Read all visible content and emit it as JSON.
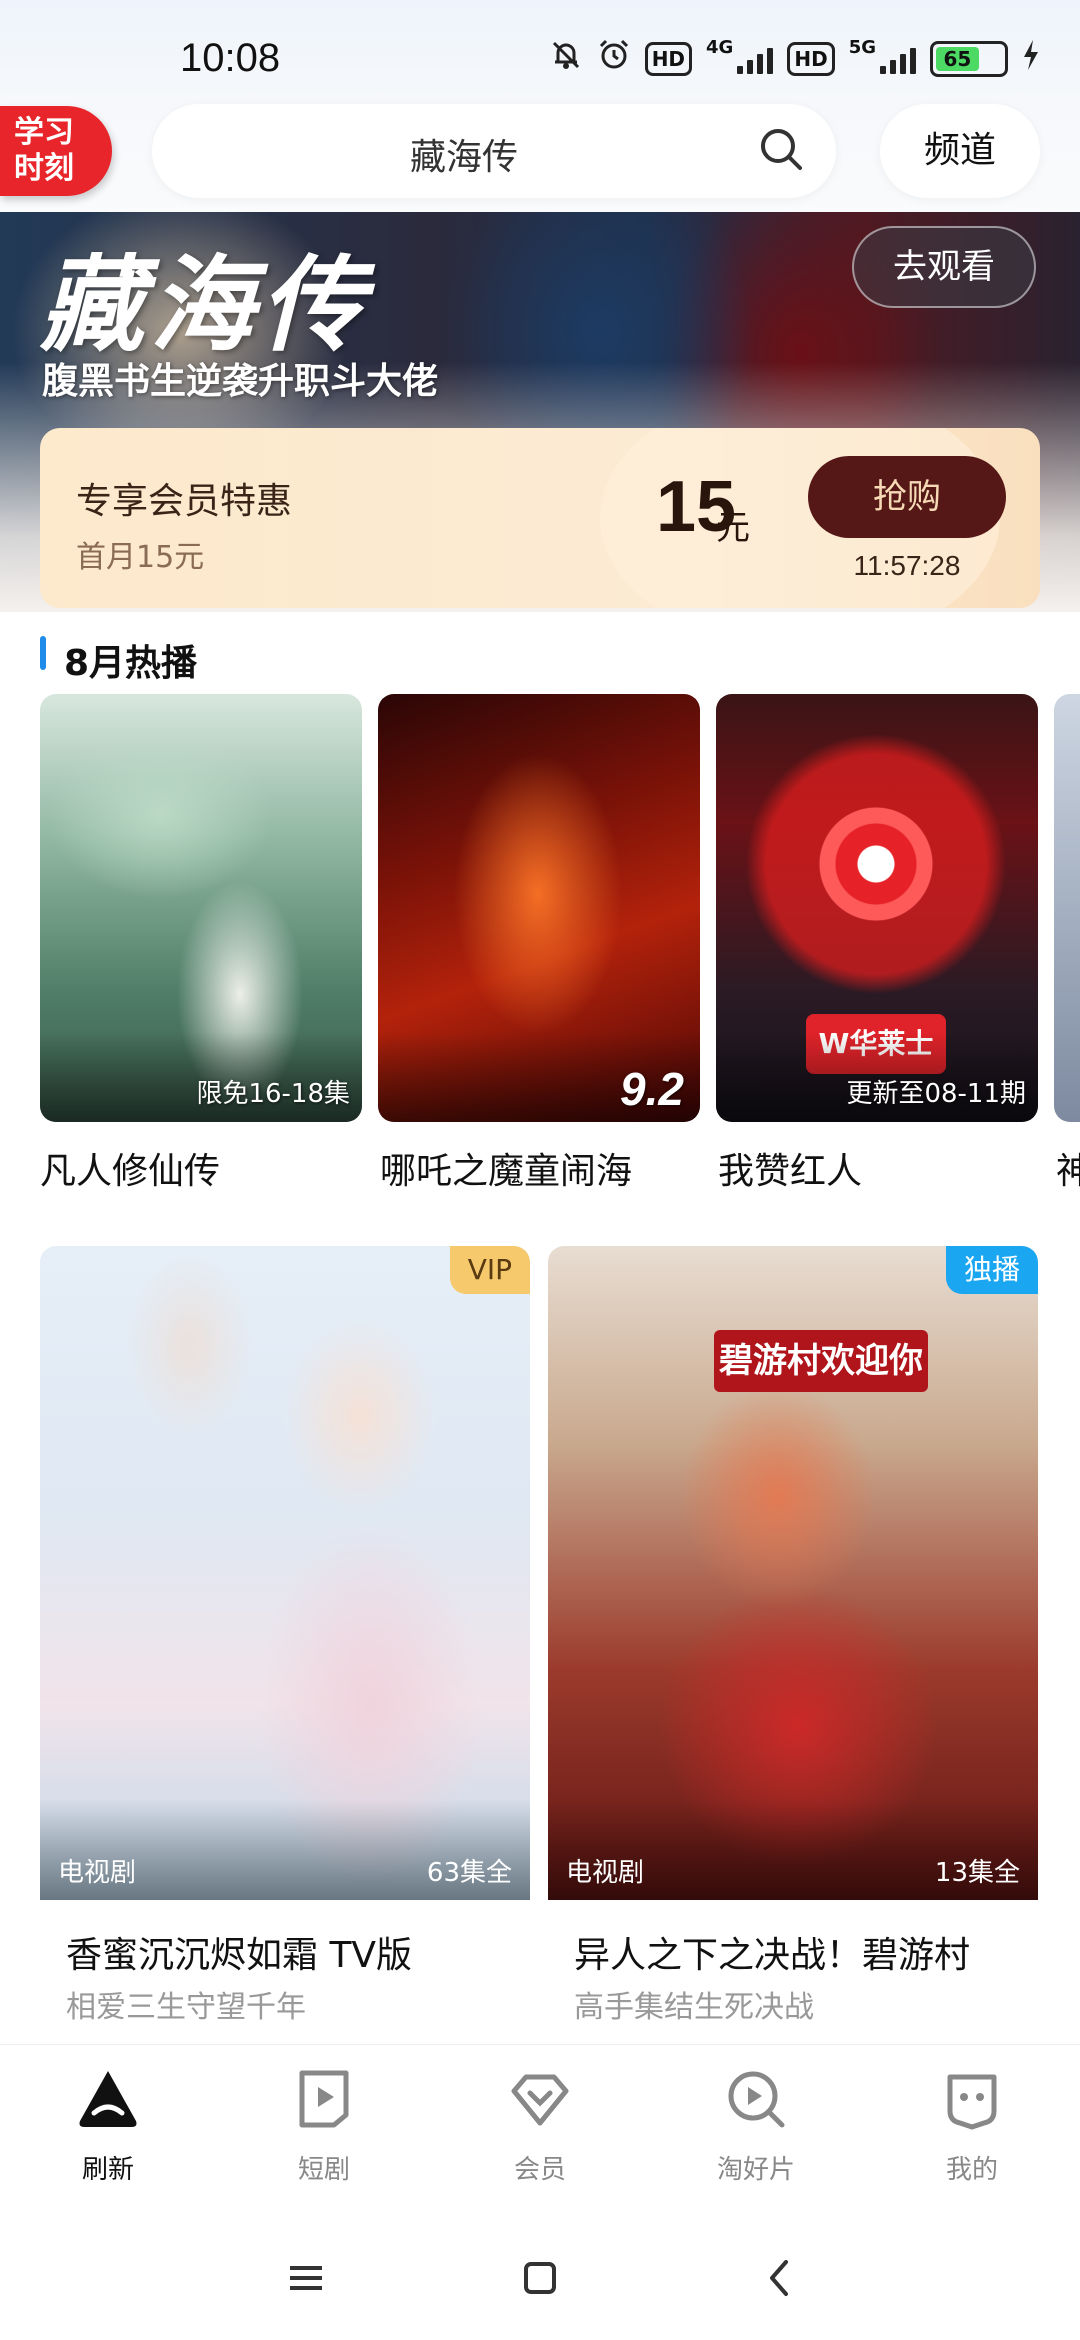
{
  "status": {
    "time": "10:08",
    "net1": "4G",
    "net2": "5G",
    "hd": "HD",
    "battery": "65"
  },
  "topbar": {
    "badge": "学习\n时刻",
    "search_text": "藏海传",
    "channel_label": "频道"
  },
  "hero": {
    "title": "藏海传",
    "subtitle": "腹黑书生逆袭升职斗大佬",
    "watch_label": "去观看"
  },
  "promo": {
    "title": "专享会员特惠",
    "subtitle": "首月15元",
    "price": "15",
    "unit": "元",
    "buy_label": "抢购",
    "countdown": "11:57:28"
  },
  "section": {
    "title": "8月热播"
  },
  "hot": [
    {
      "title": "凡人修仙传",
      "tag": "限免16-18集"
    },
    {
      "title": "哪吒之魔童闹海",
      "score": "9.2"
    },
    {
      "title": "我赞红人",
      "tag": "更新至08-11期",
      "logo": "W华莱士"
    },
    {
      "title": "神"
    }
  ],
  "cards": [
    {
      "title": "香蜜沉沉烬如霜 TV版",
      "subtitle": "相爱三生守望千年",
      "type": "电视剧",
      "episodes": "63集全",
      "badge": "VIP"
    },
    {
      "title": "异人之下之决战！碧游村",
      "subtitle": "高手集结生死决战",
      "type": "电视剧",
      "episodes": "13集全",
      "badge": "独播",
      "sign": "碧游村欢迎你"
    }
  ],
  "nav": [
    {
      "label": "刷新",
      "icon": "home-triangle-icon"
    },
    {
      "label": "短剧",
      "icon": "play-card-icon"
    },
    {
      "label": "会员",
      "icon": "diamond-icon"
    },
    {
      "label": "淘好片",
      "icon": "search-play-icon"
    },
    {
      "label": "我的",
      "icon": "face-icon"
    }
  ],
  "colors": {
    "accent_blue": "#1e8ce8",
    "badge_red": "#e8252b",
    "buy_button": "#561717",
    "promo_bg": "#fde9cc",
    "vip_gold": "#f6c96c",
    "exclusive_blue": "#1aa6f0"
  }
}
